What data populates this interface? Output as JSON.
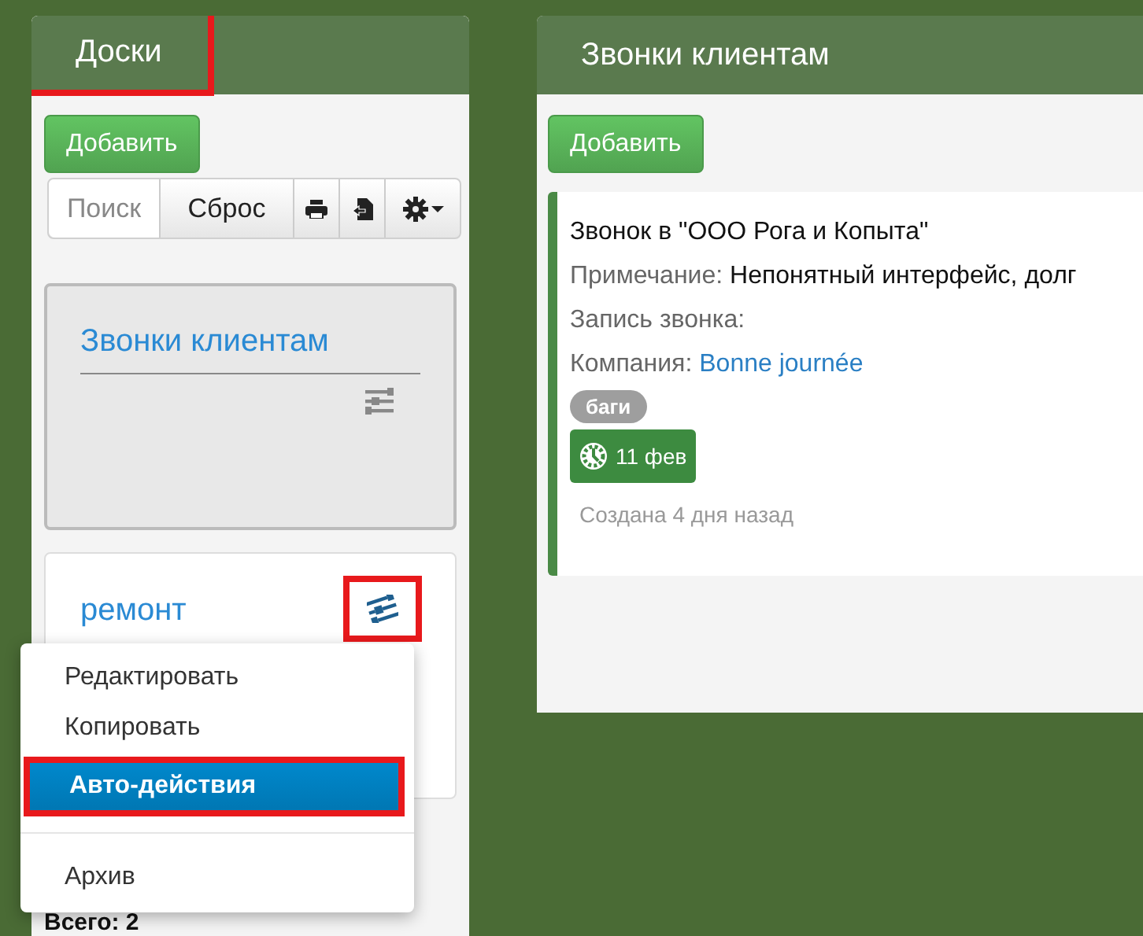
{
  "boards_column": {
    "title": "Доски",
    "title_highlighted": true,
    "add_button": "Добавить",
    "toolbar": {
      "search": "Поиск",
      "reset": "Сброс"
    },
    "boards": [
      {
        "name": "Звонки клиентам",
        "selected": true,
        "menu_open": false,
        "icon_highlighted": false
      },
      {
        "name": "ремонт",
        "selected": false,
        "menu_open": true,
        "icon_highlighted": true
      }
    ],
    "total": "Всего: 2"
  },
  "context_menu": {
    "items": [
      {
        "kind": "item",
        "label": "Редактировать",
        "selected": false,
        "highlighted": false
      },
      {
        "kind": "item",
        "label": "Копировать",
        "selected": false,
        "highlighted": false
      },
      {
        "kind": "item",
        "label": "Авто-действия",
        "selected": true,
        "highlighted": true
      },
      {
        "kind": "divider"
      },
      {
        "kind": "item",
        "label": "Архив",
        "selected": false,
        "highlighted": false
      }
    ]
  },
  "list_column": {
    "title": "Звонки клиентам",
    "add_button": "Добавить",
    "cards": [
      {
        "title": "Звонок в \"ООО Рога и Копыта\"",
        "fields": [
          {
            "label": "Примечание:",
            "value": "Непонятный интерфейс, долг",
            "kind": "text"
          },
          {
            "label": "Запись звонка:"
          },
          {
            "label": "Компания:",
            "value": "Bonne journée",
            "kind": "link"
          }
        ],
        "tags": [
          {
            "label": "баги",
            "color": "#9e9e9e"
          }
        ],
        "due": "11 фев",
        "created": "Создана 4 дня назад"
      }
    ]
  }
}
